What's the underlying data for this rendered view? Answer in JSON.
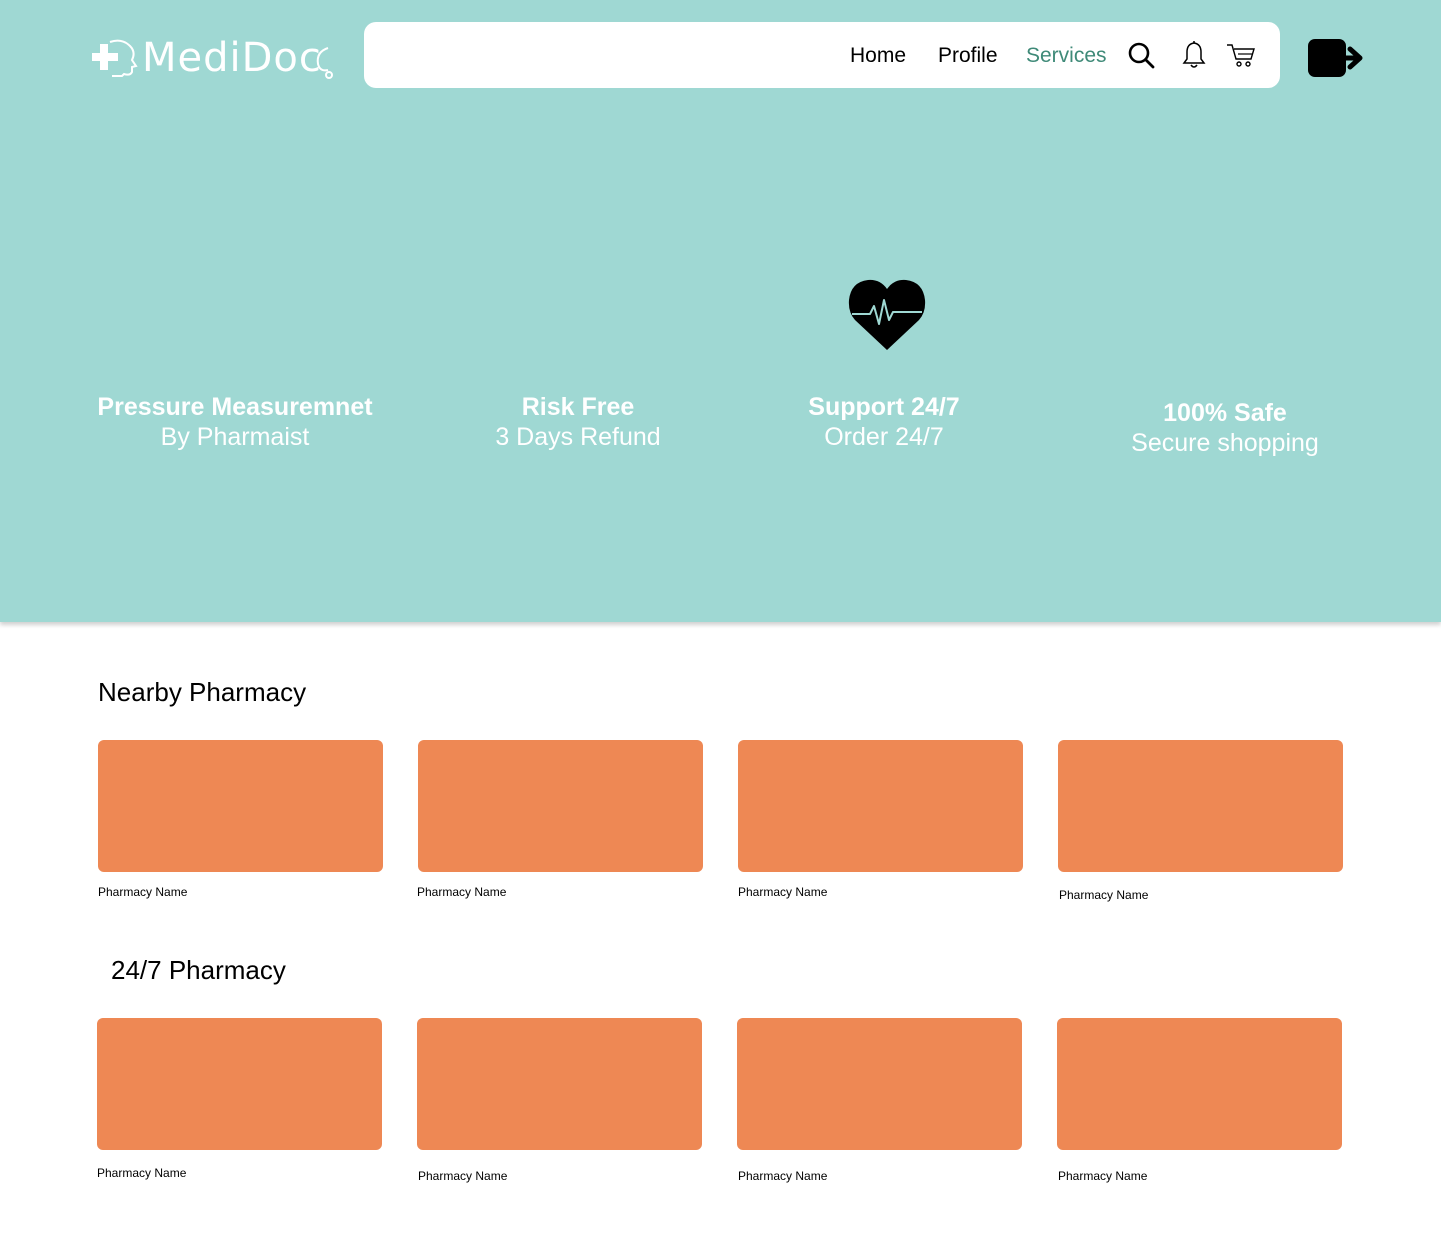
{
  "brand": {
    "name": "MediDoc"
  },
  "nav": {
    "links": [
      {
        "label": "Home",
        "active": false
      },
      {
        "label": "Profile",
        "active": false
      },
      {
        "label": "Services",
        "active": true
      }
    ],
    "icons": [
      "search-icon",
      "bell-icon",
      "cart-icon"
    ]
  },
  "logout": {
    "icon": "logout-icon"
  },
  "features": [
    {
      "title": "Pressure Measuremnet",
      "subtitle": "By Pharmaist"
    },
    {
      "title": "Risk Free",
      "subtitle": "3 Days Refund"
    },
    {
      "title": "Support 24/7",
      "subtitle": "Order 24/7",
      "icon": "heart-pulse-icon"
    },
    {
      "title": "100% Safe",
      "subtitle": "Secure shopping"
    }
  ],
  "sections": [
    {
      "title": "Nearby Pharmacy",
      "cards": [
        {
          "name": "Pharmacy Name"
        },
        {
          "name": "Pharmacy Name"
        },
        {
          "name": "Pharmacy Name"
        },
        {
          "name": "Pharmacy Name"
        }
      ]
    },
    {
      "title": "24/7 Pharmacy",
      "cards": [
        {
          "name": "Pharmacy Name"
        },
        {
          "name": "Pharmacy Name"
        },
        {
          "name": "Pharmacy Name"
        },
        {
          "name": "Pharmacy Name"
        }
      ]
    }
  ],
  "colors": {
    "hero_bg": "#9fd8d3",
    "card_bg": "#ee8854",
    "active_link": "#3f8a78"
  }
}
